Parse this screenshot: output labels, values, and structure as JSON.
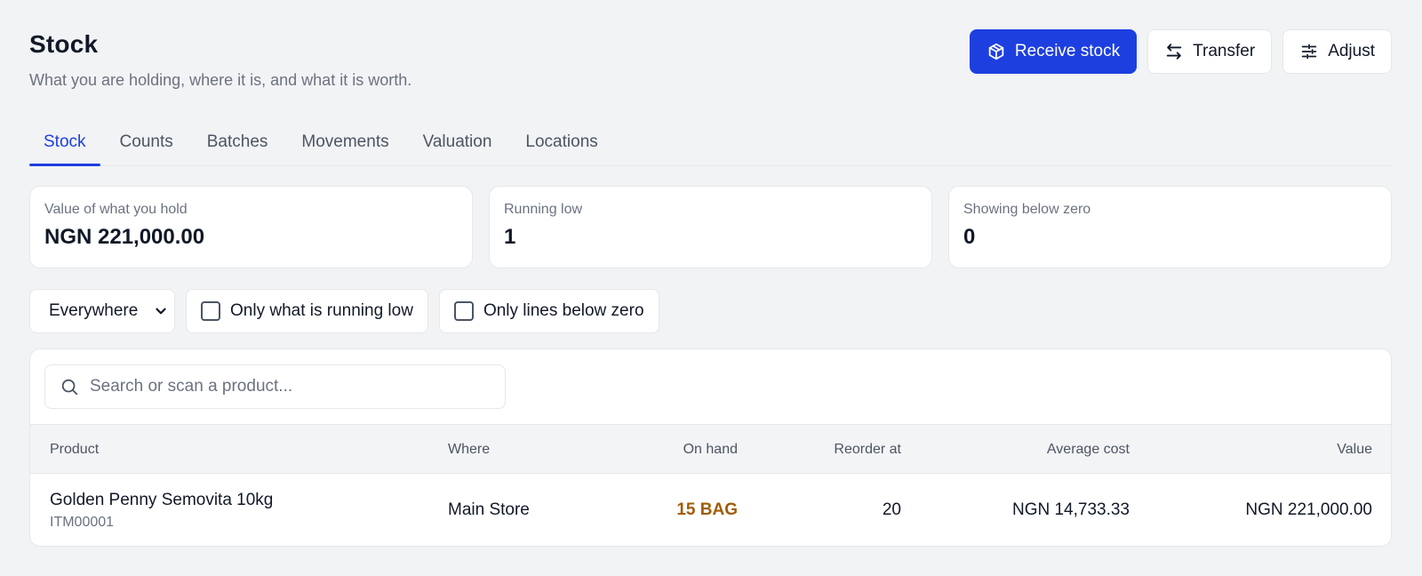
{
  "header": {
    "title": "Stock",
    "subtitle": "What you are holding, where it is, and what it is worth."
  },
  "actions": {
    "receive_label": "Receive stock",
    "transfer_label": "Transfer",
    "adjust_label": "Adjust"
  },
  "tabs": [
    {
      "label": "Stock",
      "active": true
    },
    {
      "label": "Counts"
    },
    {
      "label": "Batches"
    },
    {
      "label": "Movements"
    },
    {
      "label": "Valuation"
    },
    {
      "label": "Locations"
    }
  ],
  "summary": [
    {
      "label": "Value of what you hold",
      "value": "NGN 221,000.00"
    },
    {
      "label": "Running low",
      "value": "1"
    },
    {
      "label": "Showing below zero",
      "value": "0"
    }
  ],
  "filters": {
    "location_selected": "Everywhere",
    "running_low_label": "Only what is running low",
    "below_zero_label": "Only lines below zero"
  },
  "search": {
    "placeholder": "Search or scan a product..."
  },
  "table": {
    "columns": {
      "product": "Product",
      "where": "Where",
      "on_hand": "On hand",
      "reorder_at": "Reorder at",
      "average_cost": "Average cost",
      "value": "Value"
    },
    "rows": [
      {
        "product": "Golden Penny Semovita 10kg",
        "sku": "ITM00001",
        "where": "Main Store",
        "on_hand": "15 BAG",
        "reorder_at": "20",
        "average_cost": "NGN 14,733.33",
        "value": "NGN 221,000.00"
      }
    ]
  },
  "colors": {
    "accent": "#1d3fe0",
    "low_stock": "#a15c07",
    "background": "#f2f3f5"
  },
  "icons": {
    "receive": "package-plus-icon",
    "transfer": "arrows-left-right-icon",
    "adjust": "sliders-icon",
    "dropdown": "chevron-down-icon",
    "search": "search-icon"
  }
}
